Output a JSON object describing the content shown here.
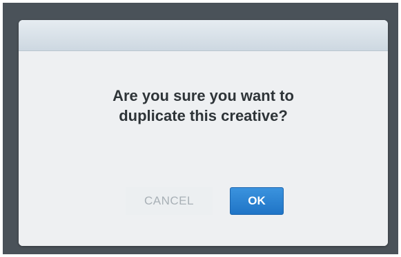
{
  "dialog": {
    "message_line1": "Are you sure you want to",
    "message_line2": "duplicate this creative?",
    "cancel_label": "CANCEL",
    "ok_label": "OK"
  },
  "colors": {
    "backdrop": "#4a5259",
    "dialog_bg": "#eef0f2",
    "header_top": "#e6ecf1",
    "header_bottom": "#cdd8e1",
    "primary_button": "#2a83d3",
    "cancel_text": "#a8b0b6",
    "message_text": "#2e3438"
  }
}
